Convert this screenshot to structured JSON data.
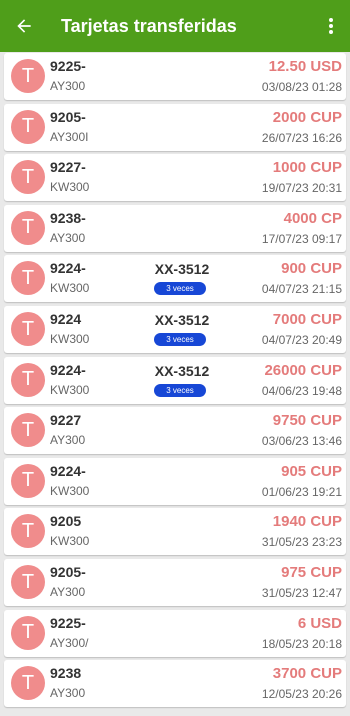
{
  "appbar": {
    "title": "Tarjetas transferidas",
    "back_icon": "arrow-left-icon",
    "more_icon": "more-vert-icon",
    "color": "#4f9e1a"
  },
  "colors": {
    "avatar": "#f08c8c",
    "amount": "#e47b7b",
    "badge": "#1747d6"
  },
  "rows": [
    {
      "avatar": "T",
      "card": "9225-",
      "code": "AY300",
      "mid": "",
      "badge": "",
      "amount": "12.50 USD",
      "date": "03/08/23 01:28"
    },
    {
      "avatar": "T",
      "card": "9205-",
      "code": "AY300I",
      "mid": "",
      "badge": "",
      "amount": "2000 CUP",
      "date": "26/07/23 16:26"
    },
    {
      "avatar": "T",
      "card": "9227-",
      "code": "KW300",
      "mid": "",
      "badge": "",
      "amount": "1000 CUP",
      "date": "19/07/23 20:31"
    },
    {
      "avatar": "T",
      "card": "9238-",
      "code": "AY300",
      "mid": "",
      "badge": "",
      "amount": "4000 CP",
      "date": "17/07/23 09:17"
    },
    {
      "avatar": "T",
      "card": "9224-",
      "code": "KW300",
      "mid": "XX-3512",
      "badge": "3 veces",
      "amount": "900 CUP",
      "date": "04/07/23 21:15"
    },
    {
      "avatar": "T",
      "card": "9224",
      "code": "KW300",
      "mid": "XX-3512",
      "badge": "3 veces",
      "amount": "7000 CUP",
      "date": "04/07/23 20:49"
    },
    {
      "avatar": "T",
      "card": "9224-",
      "code": "KW300",
      "mid": "XX-3512",
      "badge": "3 veces",
      "amount": "26000 CUP",
      "date": "04/06/23 19:48"
    },
    {
      "avatar": "T",
      "card": "9227",
      "code": "AY300",
      "mid": "",
      "badge": "",
      "amount": "9750 CUP",
      "date": "03/06/23 13:46"
    },
    {
      "avatar": "T",
      "card": "9224-",
      "code": "KW300",
      "mid": "",
      "badge": "",
      "amount": "905 CUP",
      "date": "01/06/23 19:21"
    },
    {
      "avatar": "T",
      "card": "9205",
      "code": "KW300",
      "mid": "",
      "badge": "",
      "amount": "1940 CUP",
      "date": "31/05/23 23:23"
    },
    {
      "avatar": "T",
      "card": "9205-",
      "code": "AY300",
      "mid": "",
      "badge": "",
      "amount": "975 CUP",
      "date": "31/05/23 12:47"
    },
    {
      "avatar": "T",
      "card": "9225-",
      "code": "AY300/",
      "mid": "",
      "badge": "",
      "amount": "6 USD",
      "date": "18/05/23 20:18"
    },
    {
      "avatar": "T",
      "card": "9238",
      "code": "AY300",
      "mid": "",
      "badge": "",
      "amount": "3700 CUP",
      "date": "12/05/23 20:26"
    }
  ]
}
